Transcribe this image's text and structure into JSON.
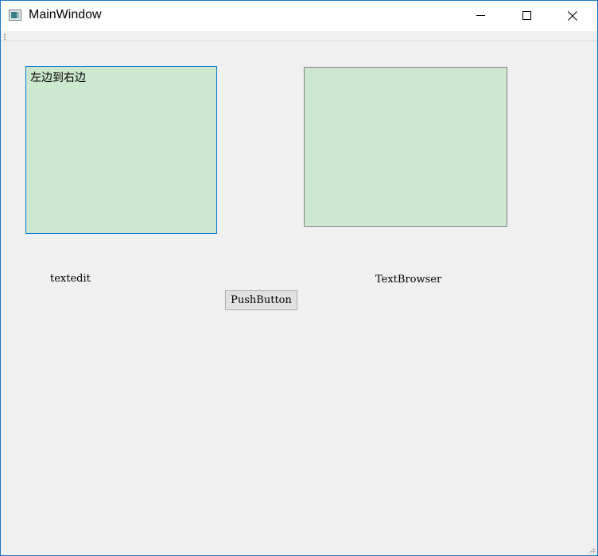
{
  "window": {
    "title": "MainWindow"
  },
  "main": {
    "textedit": {
      "value": "左边到右边"
    },
    "textbrowser": {
      "value": ""
    },
    "labels": {
      "textedit": "textedit",
      "textbrowser": "TextBrowser"
    },
    "pushbutton_label": "PushButton"
  },
  "colors": {
    "edit_background": "#cce8cf",
    "focus_border": "#0078d7",
    "window_border": "#1979ca"
  },
  "icons": {
    "app": "app-window-icon",
    "minimize": "minimize-icon",
    "maximize": "maximize-icon",
    "close": "close-icon"
  }
}
